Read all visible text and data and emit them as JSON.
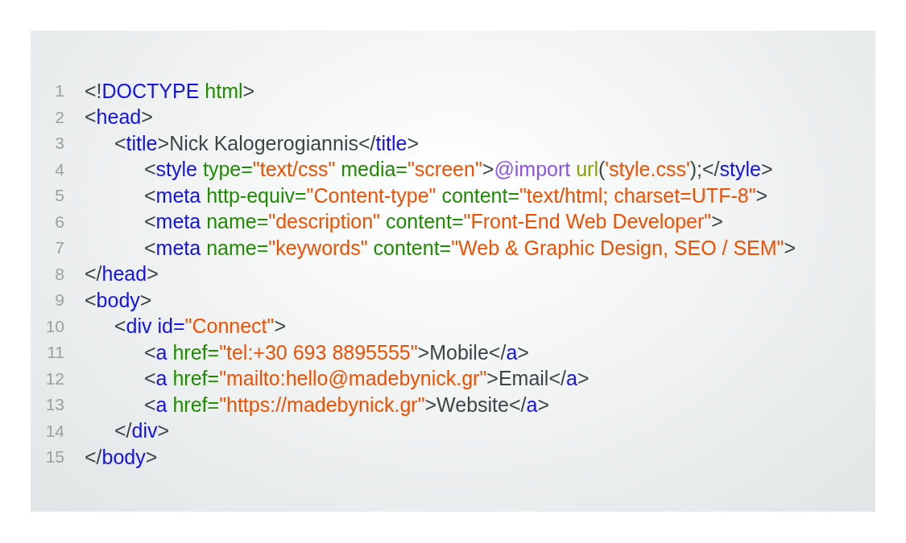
{
  "code_lines": [
    {
      "number": "1",
      "tokens": [
        {
          "kind": "punct",
          "text": "<!"
        },
        {
          "kind": "tag",
          "text": "DOCTYPE"
        },
        {
          "kind": "attr",
          "text": " html"
        },
        {
          "kind": "punct",
          "text": ">"
        }
      ]
    },
    {
      "number": "2",
      "tokens": [
        {
          "kind": "punct",
          "text": "<"
        },
        {
          "kind": "tag",
          "text": "head"
        },
        {
          "kind": "punct",
          "text": ">"
        }
      ],
      "children": [
        {
          "number": "3",
          "tokens": [
            {
              "kind": "punct",
              "text": "<"
            },
            {
              "kind": "tag",
              "text": "title"
            },
            {
              "kind": "punct",
              "text": ">"
            },
            {
              "kind": "text",
              "text": "Nick Kalogerogiannis"
            },
            {
              "kind": "punct",
              "text": "</"
            },
            {
              "kind": "tag",
              "text": "title"
            },
            {
              "kind": "punct",
              "text": ">"
            }
          ],
          "children": [
            {
              "number": "4",
              "tokens": [
                {
                  "kind": "punct",
                  "text": "<"
                },
                {
                  "kind": "tag",
                  "text": "style"
                },
                {
                  "kind": "attr",
                  "text": " type="
                },
                {
                  "kind": "string",
                  "text": "\"text/css\""
                },
                {
                  "kind": "attr",
                  "text": " media="
                },
                {
                  "kind": "string",
                  "text": "\"screen\""
                },
                {
                  "kind": "punct",
                  "text": ">"
                },
                {
                  "kind": "atrule",
                  "text": "@import"
                },
                {
                  "kind": "func",
                  "text": " url"
                },
                {
                  "kind": "punct",
                  "text": "("
                },
                {
                  "kind": "string",
                  "text": "'style.css'"
                },
                {
                  "kind": "punct",
                  "text": ");</"
                },
                {
                  "kind": "tag",
                  "text": "style"
                },
                {
                  "kind": "punct",
                  "text": ">"
                }
              ]
            },
            {
              "number": "5",
              "tokens": [
                {
                  "kind": "punct",
                  "text": "<"
                },
                {
                  "kind": "tag",
                  "text": "meta"
                },
                {
                  "kind": "attr",
                  "text": " http-equiv="
                },
                {
                  "kind": "string",
                  "text": "\"Content-type\""
                },
                {
                  "kind": "attr",
                  "text": " content="
                },
                {
                  "kind": "string",
                  "text": "\"text/html; charset=UTF-8\""
                },
                {
                  "kind": "punct",
                  "text": ">"
                }
              ]
            },
            {
              "number": "6",
              "tokens": [
                {
                  "kind": "punct",
                  "text": "<"
                },
                {
                  "kind": "tag",
                  "text": "meta"
                },
                {
                  "kind": "attr",
                  "text": " name="
                },
                {
                  "kind": "string",
                  "text": "\"description\""
                },
                {
                  "kind": "attr",
                  "text": " content="
                },
                {
                  "kind": "string",
                  "text": "\"Front-End Web Developer\""
                },
                {
                  "kind": "punct",
                  "text": ">"
                }
              ]
            },
            {
              "number": "7",
              "tokens": [
                {
                  "kind": "punct",
                  "text": "<"
                },
                {
                  "kind": "tag",
                  "text": "meta"
                },
                {
                  "kind": "attr",
                  "text": " name="
                },
                {
                  "kind": "string",
                  "text": "\"keywords\""
                },
                {
                  "kind": "attr",
                  "text": " content="
                },
                {
                  "kind": "string",
                  "text": "\"Web & Graphic Design, SEO / SEM\""
                },
                {
                  "kind": "punct",
                  "text": ">"
                }
              ]
            }
          ]
        }
      ]
    },
    {
      "number": "8",
      "tokens": [
        {
          "kind": "punct",
          "text": "</"
        },
        {
          "kind": "tag",
          "text": "head"
        },
        {
          "kind": "punct",
          "text": ">"
        }
      ]
    },
    {
      "number": "9",
      "tokens": [
        {
          "kind": "punct",
          "text": "<"
        },
        {
          "kind": "tag",
          "text": "body"
        },
        {
          "kind": "punct",
          "text": ">"
        }
      ],
      "children": [
        {
          "number": "10",
          "tokens": [
            {
              "kind": "punct",
              "text": "<"
            },
            {
              "kind": "tag",
              "text": "div id="
            },
            {
              "kind": "string",
              "text": "\"Connect\""
            },
            {
              "kind": "punct",
              "text": ">"
            }
          ],
          "children": [
            {
              "number": "11",
              "tokens": [
                {
                  "kind": "punct",
                  "text": "<"
                },
                {
                  "kind": "tag",
                  "text": "a"
                },
                {
                  "kind": "attr",
                  "text": " href="
                },
                {
                  "kind": "string",
                  "text": "\"tel:+30 693 8895555\""
                },
                {
                  "kind": "punct",
                  "text": ">"
                },
                {
                  "kind": "text",
                  "text": "Mobile"
                },
                {
                  "kind": "punct",
                  "text": "</"
                },
                {
                  "kind": "tag",
                  "text": "a"
                },
                {
                  "kind": "punct",
                  "text": ">"
                }
              ]
            },
            {
              "number": "12",
              "tokens": [
                {
                  "kind": "punct",
                  "text": "<"
                },
                {
                  "kind": "tag",
                  "text": "a"
                },
                {
                  "kind": "attr",
                  "text": " href="
                },
                {
                  "kind": "string",
                  "text": "\"mailto:hello@madebynick.gr\""
                },
                {
                  "kind": "punct",
                  "text": ">"
                },
                {
                  "kind": "text",
                  "text": "Email"
                },
                {
                  "kind": "punct",
                  "text": "</"
                },
                {
                  "kind": "tag",
                  "text": "a"
                },
                {
                  "kind": "punct",
                  "text": ">"
                }
              ]
            },
            {
              "number": "13",
              "tokens": [
                {
                  "kind": "punct",
                  "text": "<"
                },
                {
                  "kind": "tag",
                  "text": "a"
                },
                {
                  "kind": "attr",
                  "text": " href="
                },
                {
                  "kind": "string",
                  "text": "\"https://madebynick.gr\""
                },
                {
                  "kind": "punct",
                  "text": ">"
                },
                {
                  "kind": "text",
                  "text": "Website"
                },
                {
                  "kind": "punct",
                  "text": "</"
                },
                {
                  "kind": "tag",
                  "text": "a"
                },
                {
                  "kind": "punct",
                  "text": ">"
                }
              ]
            }
          ]
        },
        {
          "number": "14",
          "tokens": [
            {
              "kind": "punct",
              "text": "</"
            },
            {
              "kind": "tag",
              "text": "div"
            },
            {
              "kind": "punct",
              "text": ">"
            }
          ]
        }
      ]
    },
    {
      "number": "15",
      "tokens": [
        {
          "kind": "punct",
          "text": "</"
        },
        {
          "kind": "tag",
          "text": "body"
        },
        {
          "kind": "punct",
          "text": ">"
        }
      ]
    }
  ]
}
